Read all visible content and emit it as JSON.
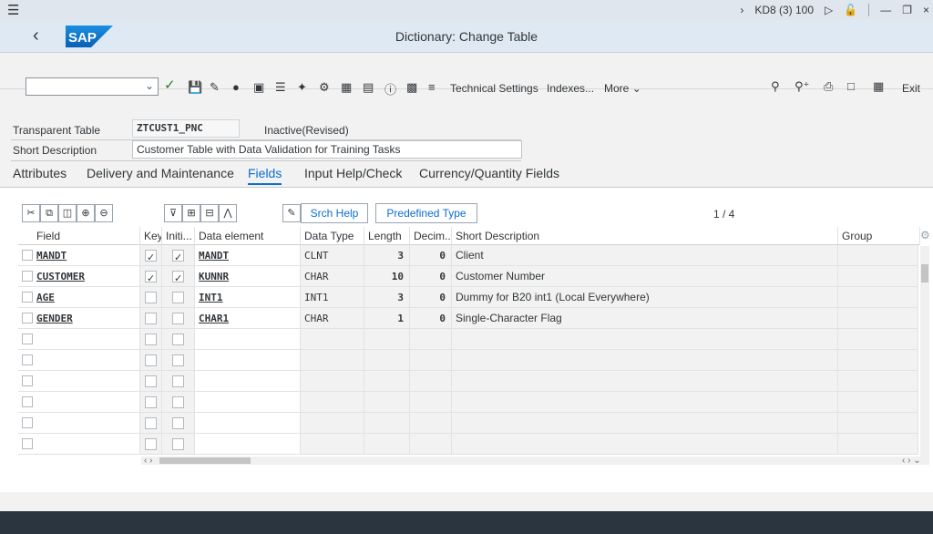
{
  "system_bar": {
    "system_info": "KD8 (3) 100"
  },
  "header": {
    "title": "Dictionary: Change Table",
    "logo_text": "SAP"
  },
  "toolbar": {
    "technical_settings": "Technical Settings",
    "indexes": "Indexes...",
    "more": "More",
    "exit": "Exit"
  },
  "form": {
    "transparent_table_label": "Transparent Table",
    "transparent_table_value": "ZTCUST1_PNC",
    "status": "Inactive(Revised)",
    "short_description_label": "Short Description",
    "short_description_value": "Customer Table with Data Validation for Training Tasks"
  },
  "tabs": [
    {
      "label": "Attributes"
    },
    {
      "label": "Delivery and Maintenance"
    },
    {
      "label": "Fields",
      "active": true
    },
    {
      "label": "Input Help/Check"
    },
    {
      "label": "Currency/Quantity Fields"
    }
  ],
  "table_toolbar": {
    "srch_help": "Srch Help",
    "predefined_type": "Predefined Type",
    "page_counter": "1 / 4"
  },
  "table": {
    "headers": {
      "field": "Field",
      "key": "Key",
      "initial": "Initi...",
      "data_element": "Data element",
      "data_type": "Data Type",
      "length": "Length",
      "decimals": "Decim...",
      "short_description": "Short Description",
      "group": "Group"
    },
    "rows": [
      {
        "field": "MANDT",
        "key": true,
        "initial": true,
        "data_element": "MANDT",
        "data_type": "CLNT",
        "length": "3",
        "decimals": "0",
        "short_description": "Client"
      },
      {
        "field": "CUSTOMER",
        "key": true,
        "initial": true,
        "data_element": "KUNNR",
        "data_type": "CHAR",
        "length": "10",
        "decimals": "0",
        "short_description": "Customer Number"
      },
      {
        "field": "AGE",
        "key": false,
        "initial": false,
        "data_element": "INT1",
        "data_type": "INT1",
        "length": "3",
        "decimals": "0",
        "short_description": "Dummy for B20 int1 (Local Everywhere)"
      },
      {
        "field": "GENDER",
        "key": false,
        "initial": false,
        "data_element": "CHAR1",
        "data_type": "CHAR",
        "length": "1",
        "decimals": "0",
        "short_description": "Single-Character Flag"
      }
    ]
  },
  "colors": {
    "accent": "#0a6ed1",
    "shell_bg": "#dfe9f3",
    "footer_bg": "#2b3540"
  }
}
